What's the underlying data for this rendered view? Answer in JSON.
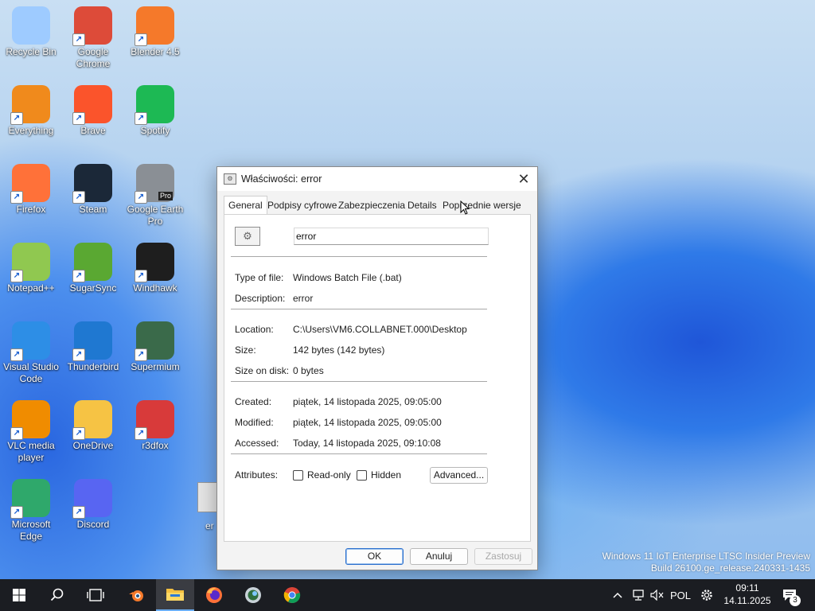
{
  "desktop_icons": [
    {
      "label": "Recycle Bin",
      "icon": "recycle-bin-icon",
      "color": "#9ecbff"
    },
    {
      "label": "Google Chrome",
      "icon": "chrome-icon",
      "color": "#dd4b39"
    },
    {
      "label": "Blender 4.5",
      "icon": "blender-icon",
      "color": "#f5792a"
    },
    {
      "label": "Everything",
      "icon": "everything-icon",
      "color": "#f08a1c"
    },
    {
      "label": "Brave",
      "icon": "brave-icon",
      "color": "#fb542b"
    },
    {
      "label": "Spotify",
      "icon": "spotify-icon",
      "color": "#1db954"
    },
    {
      "label": "Firefox",
      "icon": "firefox-icon",
      "color": "#ff7139"
    },
    {
      "label": "Steam",
      "icon": "steam-icon",
      "color": "#1b2838"
    },
    {
      "label": "Google Earth Pro",
      "icon": "google-earth-icon",
      "color": "#8a8f95",
      "badge": "Pro"
    },
    {
      "label": "Notepad++",
      "icon": "notepadpp-icon",
      "color": "#90c850"
    },
    {
      "label": "SugarSync",
      "icon": "sugarsync-icon",
      "color": "#5aa832"
    },
    {
      "label": "Windhawk",
      "icon": "windhawk-icon",
      "color": "#1e1e1e"
    },
    {
      "label": "Visual Studio Code",
      "icon": "vscode-icon",
      "color": "#2d8ee6"
    },
    {
      "label": "Thunderbird",
      "icon": "thunderbird-icon",
      "color": "#1f78d1"
    },
    {
      "label": "Supermium",
      "icon": "supermium-icon",
      "color": "#3a6a4a"
    },
    {
      "label": "VLC media player",
      "icon": "vlc-icon",
      "color": "#f08c00"
    },
    {
      "label": "OneDrive",
      "icon": "onedrive-icon",
      "color": "#f6c344"
    },
    {
      "label": "r3dfox",
      "icon": "r3dfox-icon",
      "color": "#d83a3a"
    },
    {
      "label": "Microsoft Edge",
      "icon": "edge-icon",
      "color": "#2fa86b"
    },
    {
      "label": "Discord",
      "icon": "discord-icon",
      "color": "#5865f2"
    }
  ],
  "peek_label": "er",
  "dialog": {
    "title": "Właściwości: error",
    "tabs": [
      "General",
      "Podpisy cyfrowe",
      "Zabezpieczenia",
      "Details",
      "Poprzednie wersje"
    ],
    "active_tab": "General",
    "file_name": "error",
    "rows": {
      "type_label": "Type of file:",
      "type_value": "Windows Batch File (.bat)",
      "desc_label": "Description:",
      "desc_value": "error",
      "location_label": "Location:",
      "location_value": "C:\\Users\\VM6.COLLABNET.000\\Desktop",
      "size_label": "Size:",
      "size_value": "142 bytes (142 bytes)",
      "size_disk_label": "Size on disk:",
      "size_disk_value": "0 bytes",
      "created_label": "Created:",
      "created_value": "piątek, 14 listopada 2025, 09:05:00",
      "modified_label": "Modified:",
      "modified_value": "piątek, 14 listopada 2025, 09:05:00",
      "accessed_label": "Accessed:",
      "accessed_value": "Today, 14 listopada 2025, 09:10:08",
      "attributes_label": "Attributes:"
    },
    "readonly_label": "Read-only",
    "hidden_label": "Hidden",
    "advanced_label": "Advanced...",
    "ok_label": "OK",
    "cancel_label": "Anuluj",
    "apply_label": "Zastosuj"
  },
  "watermark": {
    "line1": "Windows 11 IoT Enterprise LTSC Insider Preview",
    "line2": "Build 26100.ge_release.240331-1435"
  },
  "taskbar": {
    "apps": [
      "start-icon",
      "search-icon",
      "task-view-icon",
      "blender-icon",
      "file-explorer-icon",
      "firefox-icon",
      "supermium-icon",
      "chrome-icon"
    ],
    "language": "POL",
    "time": "09:11",
    "date": "14.11.2025",
    "notification_count": "3"
  }
}
